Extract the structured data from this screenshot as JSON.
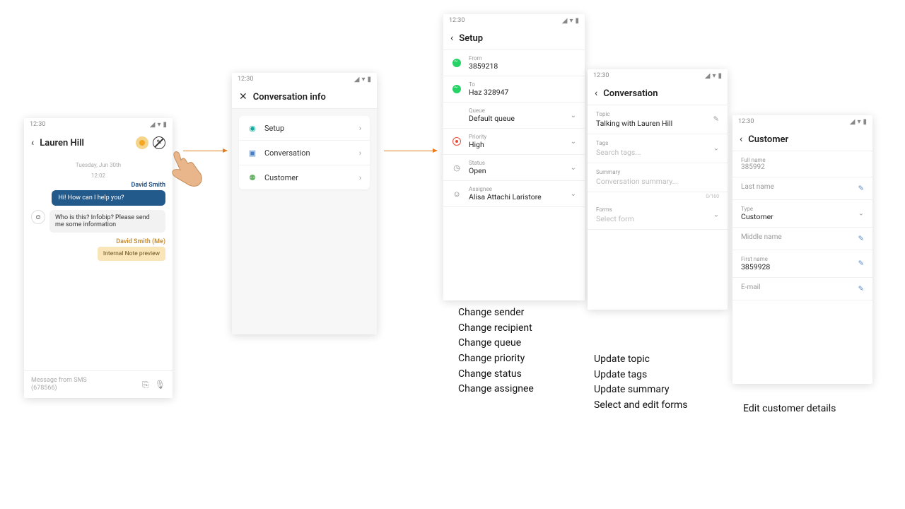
{
  "status_time": "12:30",
  "screen1": {
    "title": "Lauren Hill",
    "date": "Tuesday, Jun 30th",
    "time1": "12:02",
    "sender1": "David Smith",
    "msg1": "Hi! How can I help you?",
    "msg2": "Who is this? Infobip? Please send me some information",
    "sender2": "David Smith (Me)",
    "note": "Internal Note preview",
    "composer_line1": "Message from SMS",
    "composer_line2": "(678566)"
  },
  "screen2": {
    "title": "Conversation info",
    "items": [
      {
        "label": "Setup"
      },
      {
        "label": "Conversation"
      },
      {
        "label": "Customer"
      }
    ]
  },
  "screen3": {
    "title": "Setup",
    "from_label": "From",
    "from_value": "3859218",
    "to_label": "To",
    "to_value": "Haz 328947",
    "queue_label": "Queue",
    "queue_value": "Default queue",
    "priority_label": "Priority",
    "priority_value": "High",
    "status_label": "Status",
    "status_value": "Open",
    "assignee_label": "Assignee",
    "assignee_value": "Alisa Attachi Laristore"
  },
  "screen4": {
    "title": "Conversation",
    "topic_label": "Topic",
    "topic_value": "Talking with Lauren Hill",
    "tags_label": "Tags",
    "tags_placeholder": "Search tags...",
    "summary_label": "Summary",
    "summary_placeholder": "Conversation summary...",
    "summary_counter": "0/160",
    "forms_label": "Forms",
    "forms_placeholder": "Select form"
  },
  "screen5": {
    "title": "Customer",
    "fullname_label": "Full name",
    "fullname_value": "385992",
    "lastname_label": "Last name",
    "type_label": "Type",
    "type_value": "Customer",
    "middlename_label": "Middle name",
    "firstname_label": "First name",
    "firstname_value": "3859928",
    "email_label": "E-mail"
  },
  "captions": {
    "c3": [
      "Change sender",
      "Change recipient",
      "Change queue",
      "Change priority",
      "Change status",
      "Change assignee"
    ],
    "c4": [
      "Update topic",
      "Update tags",
      "Update summary",
      "Select and edit forms"
    ],
    "c5": "Edit customer details"
  }
}
